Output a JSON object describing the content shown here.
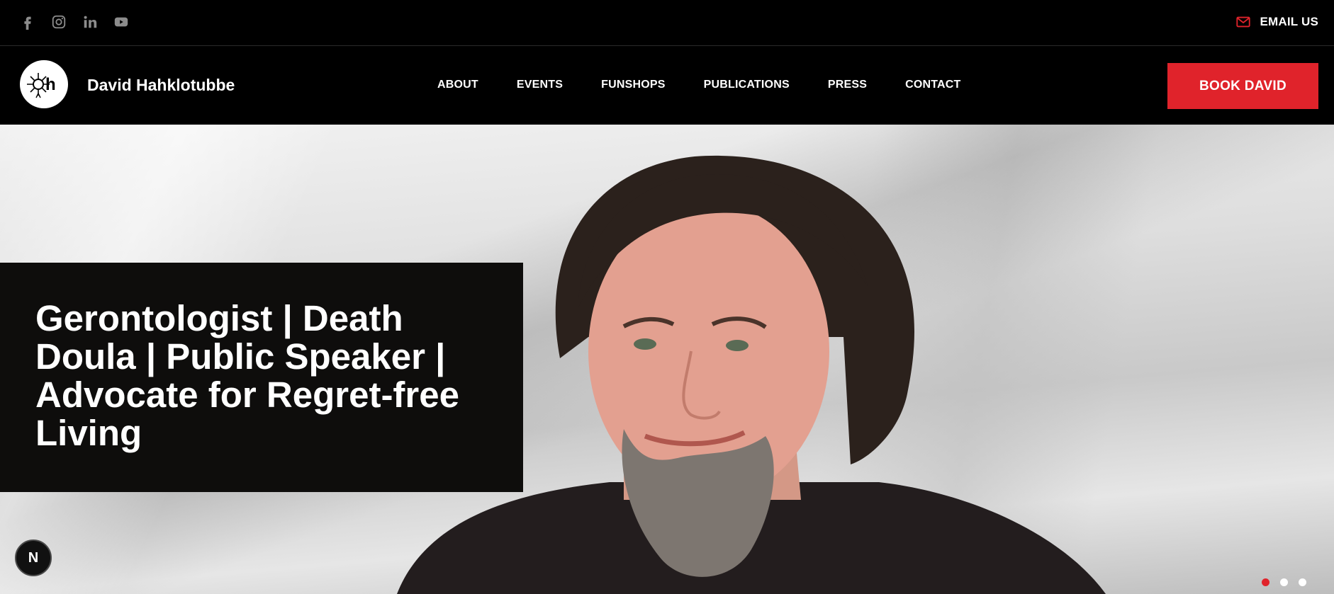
{
  "topbar": {
    "socials": [
      "facebook-icon",
      "instagram-icon",
      "linkedin-icon",
      "youtube-icon"
    ],
    "email_label": "EMAIL US"
  },
  "navbar": {
    "brand": "David Hahklotubbe",
    "logo_text": "h",
    "items": [
      "ABOUT",
      "EVENTS",
      "FUNSHOPS",
      "PUBLICATIONS",
      "PRESS",
      "CONTACT"
    ],
    "cta_label": "BOOK DAVID"
  },
  "hero": {
    "headline": "Gerontologist | Death Doula | Public Speaker | Advocate for Regret-free Living",
    "badge_letter": "N",
    "slide_count": 3,
    "active_slide": 1
  },
  "colors": {
    "accent": "#e0232b",
    "background": "#000000",
    "headline_box": "#0e0d0c"
  }
}
